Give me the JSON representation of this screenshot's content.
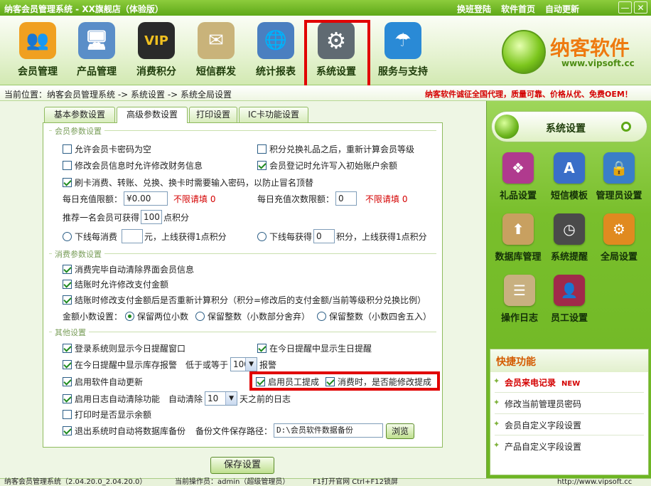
{
  "window": {
    "title": "纳客会员管理系统 - XX旗舰店（体验版）",
    "links": [
      "换班登陆",
      "软件首页",
      "自动更新"
    ],
    "controls": [
      "—",
      "✕"
    ]
  },
  "nav": [
    {
      "label": "会员管理",
      "icon": "members-icon",
      "glyph": "👥",
      "color": "#f0a020"
    },
    {
      "label": "产品管理",
      "icon": "monitor-icon",
      "glyph": "🖥",
      "color": "#5a8ec8"
    },
    {
      "label": "消费积分",
      "icon": "vip-card-icon",
      "glyph": "VIP",
      "color": "#2a2a2a"
    },
    {
      "label": "短信群发",
      "icon": "envelope-pen-icon",
      "glyph": "✉",
      "color": "#c9b37a"
    },
    {
      "label": "统计报表",
      "icon": "globe-clock-icon",
      "glyph": "🌐",
      "color": "#4a7fc0"
    },
    {
      "label": "系统设置",
      "icon": "gear-icon",
      "glyph": "⚙",
      "color": "#606a72"
    },
    {
      "label": "服务与支持",
      "icon": "umbrella-icon",
      "glyph": "☂",
      "color": "#2a8ad6"
    }
  ],
  "logo": {
    "brand": "纳客软件",
    "url": "www.vipsoft.cc"
  },
  "breadcrumb": "当前位置：纳客会员管理系统 -> 系统设置 -> 系统全局设置",
  "promo": "纳客软件诚征全国代理，质量可靠、价格从优、免费OEM！",
  "tabs": [
    "基本参数设置",
    "高级参数设置",
    "打印设置",
    "IC卡功能设置"
  ],
  "sections": {
    "member": "会员参数设置",
    "consume": "消费参数设置",
    "other": "其他设置"
  },
  "member": {
    "allow_empty_pwd": {
      "label": "允许会员卡密码为空",
      "checked": false
    },
    "recalc_level": {
      "label": "积分兑换礼品之后，重新计算会员等级",
      "checked": false
    },
    "edit_finance": {
      "label": "修改会员信息时允许修改财务信息",
      "checked": false
    },
    "init_balance": {
      "label": "会员登记时允许写入初始账户余额",
      "checked": true
    },
    "need_pwd": {
      "label": "刷卡消费、转账、兑换、换卡时需要输入密码，以防止冒名顶替",
      "checked": true
    },
    "daily_limit_label": "每日充值限额：",
    "daily_limit_value": "¥0.00",
    "daily_limit_hint": "不限请填 0",
    "daily_count_label": "每日充值次数限额：",
    "daily_count_value": "0",
    "daily_count_hint": "不限请填 0",
    "recommend_pre": "推荐一名会员可获得",
    "recommend_value": "100",
    "recommend_post": "点积分",
    "downline_spend": {
      "pre": "下线每消费",
      "value": "",
      "post": "元，上线获得1点积分",
      "checked": false
    },
    "downline_earn": {
      "pre": "下线每获得",
      "value": "0",
      "post": "积分，上线获得1点积分",
      "checked": false
    }
  },
  "consume": {
    "auto_clear": {
      "label": "消费完毕自动清除界面会员信息",
      "checked": true
    },
    "allow_edit_pay": {
      "label": "结账时允许修改支付金额",
      "checked": true
    },
    "recalc_points": {
      "label": "结账时修改支付金额后是否重新计算积分（积分=修改后的支付金额/当前等级积分兑换比例）",
      "checked": true
    },
    "decimal_label": "金额小数设置：",
    "decimal_options": [
      {
        "label": "保留两位小数",
        "checked": true
      },
      {
        "label": "保留整数（小数部分舍弃）",
        "checked": false
      },
      {
        "label": "保留整数（小数四舍五入）",
        "checked": false
      }
    ]
  },
  "other": {
    "show_reminder": {
      "label": "登录系统则显示今日提醒窗口",
      "checked": true
    },
    "show_birthday": {
      "label": "在今日提醒中显示生日提醒",
      "checked": true
    },
    "show_stock": {
      "label": "在今日提醒中显示库存报警",
      "checked": true
    },
    "stock_pre": "低于或等于",
    "stock_value": "100",
    "stock_post": "报警",
    "auto_update": {
      "label": "启用软件自动更新",
      "checked": true
    },
    "staff_commission": {
      "label": "启用员工提成",
      "checked": true
    },
    "edit_commission": {
      "label": "消费时，是否能修改提成",
      "checked": true
    },
    "auto_clear_log": {
      "label": "启用日志自动清除功能",
      "checked": true
    },
    "clear_pre": "自动清除",
    "clear_value": "10",
    "clear_post": "天之前的日志",
    "print_balance": {
      "label": "打印时是否显示余额",
      "checked": false
    },
    "auto_backup": {
      "label": "退出系统时自动将数据库备份",
      "checked": true
    },
    "backup_path_label": "备份文件保存路径：",
    "backup_path_value": "D:\\会员软件数据备份",
    "browse_label": "浏览"
  },
  "save_label": "保存设置",
  "sidebar": {
    "title": "系统设置",
    "items": [
      {
        "label": "礼品设置",
        "icon": "gift-icon",
        "glyph": "❖",
        "color": "#b03a8e"
      },
      {
        "label": "短信模板",
        "icon": "sms-template-icon",
        "glyph": "A",
        "color": "#3a6ec8"
      },
      {
        "label": "管理员设置",
        "icon": "admin-lock-icon",
        "glyph": "🔒",
        "color": "#3a7ec8"
      },
      {
        "label": "数据库管理",
        "icon": "database-icon",
        "glyph": "⬆",
        "color": "#c8a060"
      },
      {
        "label": "系统提醒",
        "icon": "clock-icon",
        "glyph": "◷",
        "color": "#4a4a4a"
      },
      {
        "label": "全局设置",
        "icon": "global-settings-icon",
        "glyph": "⚙",
        "color": "#e08a20"
      },
      {
        "label": "操作日志",
        "icon": "log-icon",
        "glyph": "☰",
        "color": "#c8b080"
      },
      {
        "label": "员工设置",
        "icon": "staff-icon",
        "glyph": "👤",
        "color": "#a02a4a"
      }
    ],
    "quick_title": "快捷功能",
    "quick": [
      {
        "label": "会员来电记录",
        "badge": "NEW",
        "hot": true
      },
      {
        "label": "修改当前管理员密码",
        "badge": "",
        "hot": false
      },
      {
        "label": "会员自定义字段设置",
        "badge": "",
        "hot": false
      },
      {
        "label": "产品自定义字段设置",
        "badge": "",
        "hot": false
      }
    ]
  },
  "status": {
    "version": "纳客会员管理系统（2.04.20.0_2.04.20.0）",
    "operator": "当前操作员：admin（超级管理员）",
    "hotkeys": "F1打开官网 Ctrl+F12锁屏",
    "site": "http://www.vipsoft.cc"
  }
}
